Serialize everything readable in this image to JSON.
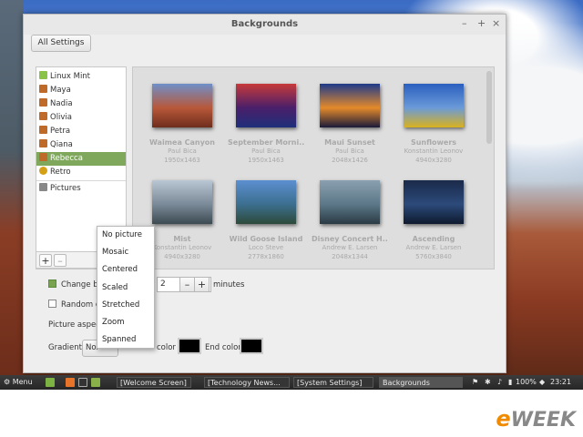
{
  "window": {
    "title": "Backgrounds",
    "controls": [
      "–",
      "+",
      "×"
    ],
    "all_settings_label": "All Settings"
  },
  "sidebar": {
    "items": [
      {
        "label": "Linux Mint",
        "icon": "folder-mint-icon",
        "color": "#8bc34a"
      },
      {
        "label": "Maya",
        "icon": "image-folder-icon",
        "color": "#c06a2a"
      },
      {
        "label": "Nadia",
        "icon": "image-folder-icon",
        "color": "#c06a2a"
      },
      {
        "label": "Olivia",
        "icon": "image-folder-icon",
        "color": "#c06a2a"
      },
      {
        "label": "Petra",
        "icon": "image-folder-icon",
        "color": "#c06a2a"
      },
      {
        "label": "Qiana",
        "icon": "image-folder-icon",
        "color": "#c06a2a"
      },
      {
        "label": "Rebecca",
        "icon": "image-folder-icon",
        "color": "#c06a2a",
        "selected": true
      },
      {
        "label": "Retro",
        "icon": "retro-icon",
        "color": "#d4a017"
      },
      {
        "label": "Pictures",
        "icon": "pictures-folder-icon",
        "color": "#888888"
      }
    ],
    "add_label": "+",
    "remove_label": "–"
  },
  "gallery": [
    {
      "name": "Waimea Canyon",
      "author": "Paul Bica",
      "size": "1950x1463",
      "colors": [
        "#6f8fc9",
        "#b8583a",
        "#6e2d1c"
      ]
    },
    {
      "name": "September Morni...",
      "author": "Paul Bica",
      "size": "1950x1463",
      "colors": [
        "#c73a3a",
        "#4a1f6a",
        "#1f2f7a"
      ]
    },
    {
      "name": "Maui Sunset",
      "author": "Paul Bica",
      "size": "2048x1426",
      "colors": [
        "#1e3a8a",
        "#e48a2a",
        "#1a1a3a"
      ]
    },
    {
      "name": "Sunflowers",
      "author": "Konstantin Leonov",
      "size": "4940x3280",
      "colors": [
        "#2b5fbf",
        "#6a9ad8",
        "#d9b21e"
      ]
    },
    {
      "name": "Mist",
      "author": "Konstantin Leonov",
      "size": "4940x3280",
      "colors": [
        "#b9c6d4",
        "#7b8a98",
        "#3c4a52"
      ]
    },
    {
      "name": "Wild Goose Island",
      "author": "Loco Steve",
      "size": "2778x1860",
      "colors": [
        "#5c8fd0",
        "#3c6f8f",
        "#2d4a3a"
      ]
    },
    {
      "name": "Disney Concert H...",
      "author": "Andrew E. Larsen",
      "size": "2048x1344",
      "colors": [
        "#8aa0b0",
        "#5c7888",
        "#2a3a44"
      ]
    },
    {
      "name": "Ascending",
      "author": "Andrew E. Larsen",
      "size": "5760x3840",
      "colors": [
        "#1a2a4a",
        "#2c4a7a",
        "#0e1a2e"
      ]
    }
  ],
  "settings": {
    "change_background_label": "Change ba",
    "change_background_checked": true,
    "interval_value": "2",
    "minus_label": "–",
    "plus_label": "+",
    "minutes_label": "minutes",
    "random_order_label": "Random or",
    "random_order_checked": false,
    "picture_aspect_label": "Picture aspect",
    "gradient_label": "Gradient",
    "gradient_value": "Nor",
    "start_color_label": "color",
    "end_color_label": "End color",
    "start_color": "#000000",
    "end_color": "#000000"
  },
  "aspect_menu": [
    "No picture",
    "Mosaic",
    "Centered",
    "Scaled",
    "Stretched",
    "Zoom",
    "Spanned"
  ],
  "taskbar": {
    "menu_label": "Menu",
    "windows": [
      {
        "label": "[Welcome Screen]",
        "active": false
      },
      {
        "label": "[Technology News...",
        "active": false
      },
      {
        "label": "[System Settings]",
        "active": false
      },
      {
        "label": "Backgrounds",
        "active": true
      }
    ],
    "battery": "100%",
    "time": "23:21"
  },
  "watermark": {
    "e": "e",
    "rest": "WEEK"
  }
}
